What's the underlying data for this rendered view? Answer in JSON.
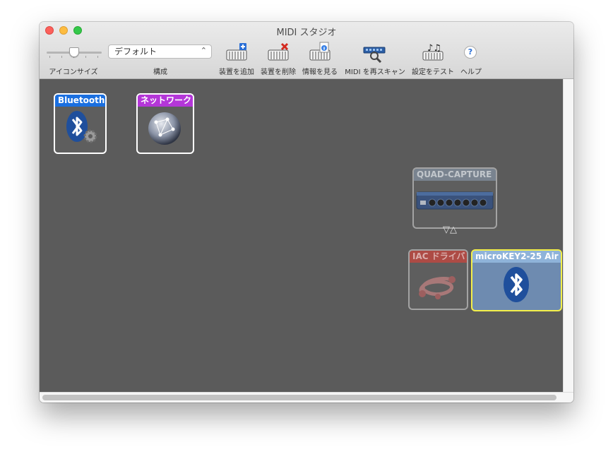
{
  "window": {
    "title": "MIDI スタジオ"
  },
  "toolbar": {
    "icon_size_label": "アイコンサイズ",
    "config_label": "構成",
    "config_value": "デフォルト",
    "add_device_label": "装置を追加",
    "remove_device_label": "装置を削除",
    "show_info_label": "情報を見る",
    "rescan_label": "MIDI を再スキャン",
    "test_setup_label": "設定をテスト",
    "help_label": "ヘルプ",
    "help_glyph": "?"
  },
  "devices": {
    "bluetooth": {
      "name": "Bluetooth",
      "color": "#1a6fe0",
      "icon": "bluetooth-gear-icon"
    },
    "network": {
      "name": "ネットワーク",
      "color": "#b436d8",
      "icon": "network-globe-icon"
    },
    "quad_capture": {
      "name": "QUAD-CAPTURE",
      "color": "#7d8a98",
      "icon": "audio-interface-icon",
      "ports": "▽△"
    },
    "iac_driver": {
      "name": "IAC ドライバ",
      "color": "#b8473f",
      "icon": "midi-cable-icon"
    },
    "microkey": {
      "name": "microKEY2-25 Air",
      "color": "#8fb3d9",
      "icon": "bluetooth-icon"
    }
  }
}
